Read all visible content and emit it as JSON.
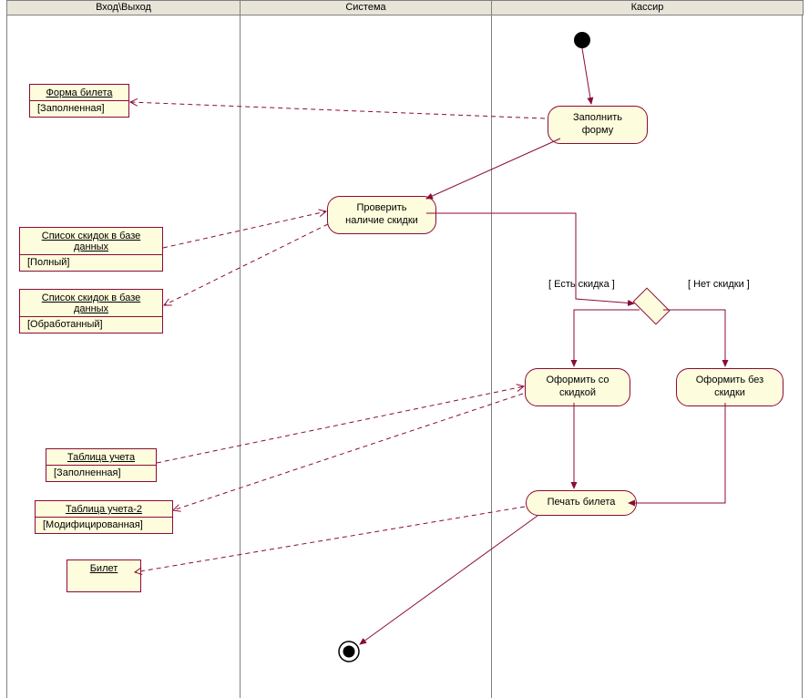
{
  "swimlanes": {
    "lane1": "Вход\\Выход",
    "lane2": "Система",
    "lane3": "Кассир"
  },
  "objects": {
    "ticket_form": {
      "title": "Форма билета",
      "state": "[Заполненная]"
    },
    "discount_list_full": {
      "title": "Список скидок в базе данных",
      "state": "[Полный]"
    },
    "discount_list_processed": {
      "title": "Список скидок в базе данных",
      "state": "[Обработанный]"
    },
    "accounting_table": {
      "title": "Таблица учета",
      "state": "[Заполненная]"
    },
    "accounting_table2": {
      "title": "Таблица учета-2",
      "state": "[Модифицированная]"
    },
    "ticket": {
      "title": "Билет",
      "state": ""
    }
  },
  "activities": {
    "fill_form": "Заполнить форму",
    "check_discount": "Проверить наличие скидки",
    "apply_with_discount": "Оформить со скидкой",
    "apply_without_discount": "Оформить без скидки",
    "print_ticket": "Печать билета"
  },
  "guards": {
    "has_discount": "[ Есть скидка ]",
    "no_discount": "[ Нет скидки ]"
  }
}
